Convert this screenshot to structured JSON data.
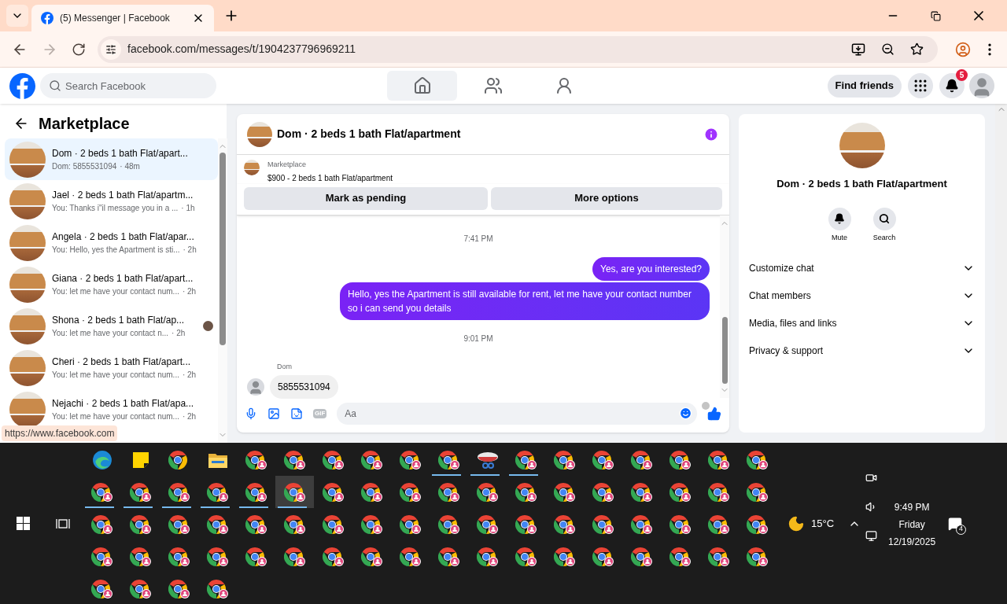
{
  "browser": {
    "tab_title": "(5) Messenger | Facebook",
    "url": "facebook.com/messages/t/1904237796969211",
    "forward_disabled": true,
    "status_url": "https://www.facebook.com"
  },
  "header": {
    "search_placeholder": "Search Facebook",
    "nav": [
      {
        "kind": "home",
        "selected": true
      },
      {
        "kind": "friends",
        "selected": false
      },
      {
        "kind": "groups",
        "selected": false
      }
    ],
    "find_friends": "Find friends",
    "notification_count": "5"
  },
  "sidebar": {
    "title": "Marketplace",
    "chats": [
      {
        "name": "Dom · 2 beds 1 bath Flat/apart...",
        "preview": "Dom: 5855531094",
        "time": "· 48m",
        "selected": true,
        "seen_avatar": false
      },
      {
        "name": "Jael · 2 beds 1 bath Flat/apartm...",
        "preview": "You: Thanks i\"il message you in a ...",
        "time": "· 1h",
        "selected": false,
        "seen_avatar": false
      },
      {
        "name": "Angela · 2 beds 1 bath Flat/apar...",
        "preview": "You: Hello, yes the Apartment is sti...",
        "time": "· 2h",
        "selected": false,
        "seen_avatar": false
      },
      {
        "name": "Giana · 2 beds 1 bath Flat/apart...",
        "preview": "You: let me have your contact num...",
        "time": "· 2h",
        "selected": false,
        "seen_avatar": false
      },
      {
        "name": "Shona · 2 beds 1 bath Flat/ap...",
        "preview": "You: let me have your contact n...",
        "time": "· 2h",
        "selected": false,
        "seen_avatar": true
      },
      {
        "name": "Cheri · 2 beds 1 bath Flat/apart...",
        "preview": "You: let me have your contact num...",
        "time": "· 2h",
        "selected": false,
        "seen_avatar": false
      },
      {
        "name": "Nejachi · 2 beds 1 bath Flat/apa...",
        "preview": "You: let me have your contact num...",
        "time": "· 2h",
        "selected": false,
        "seen_avatar": false
      }
    ]
  },
  "chat": {
    "title": "Dom · 2 beds 1 bath Flat/apartment",
    "listing": {
      "source": "Marketplace",
      "summary": "$900 - 2 beds 1 bath Flat/apartment"
    },
    "actions": [
      "Mark as pending",
      "More options"
    ],
    "messages": [
      {
        "kind": "time",
        "text": "7:41 PM"
      },
      {
        "kind": "outgoing",
        "text": "Yes, are you interested?"
      },
      {
        "kind": "outgoing",
        "text": "Hello, yes the Apartment is still available for rent, let me have your contact number so i can send you details"
      },
      {
        "kind": "time",
        "text": "9:01 PM"
      },
      {
        "kind": "incoming",
        "sender": "Dom",
        "text": "5855531094"
      }
    ],
    "composer": {
      "gif_label": "GIF",
      "placeholder": "Aa"
    }
  },
  "details": {
    "title": "Dom · 2 beds 1 bath Flat/apartment",
    "actions": [
      {
        "kind": "mute",
        "label": "Mute"
      },
      {
        "kind": "search",
        "label": "Search"
      }
    ],
    "sections": [
      {
        "label": "Customize chat",
        "expanded": false
      },
      {
        "label": "Chat members",
        "expanded": false
      },
      {
        "label": "Media, files and links",
        "expanded": false
      },
      {
        "label": "Privacy & support",
        "expanded": false
      }
    ]
  },
  "taskbar": {
    "rows": [
      [
        {
          "kind": "edge",
          "running": false,
          "selected": false
        },
        {
          "kind": "notes",
          "running": false,
          "selected": false
        },
        {
          "kind": "chrome",
          "running": false,
          "selected": false
        },
        {
          "kind": "folder",
          "running": false,
          "selected": false
        },
        {
          "kind": "chrome-profile",
          "running": false,
          "selected": false
        },
        {
          "kind": "chrome-profile",
          "running": false,
          "selected": false
        },
        {
          "kind": "chrome-profile",
          "running": false,
          "selected": false
        },
        {
          "kind": "chrome-profile",
          "running": false,
          "selected": false
        },
        {
          "kind": "chrome-profile",
          "running": false,
          "selected": false
        },
        {
          "kind": "chrome-profile",
          "running": true,
          "selected": false
        },
        {
          "kind": "scissors",
          "running": true,
          "selected": false
        },
        {
          "kind": "chrome-profile",
          "running": true,
          "selected": false
        },
        {
          "kind": "chrome-profile",
          "running": false,
          "selected": false
        },
        {
          "kind": "chrome-profile",
          "running": false,
          "selected": false
        },
        {
          "kind": "chrome-profile",
          "running": false,
          "selected": false
        },
        {
          "kind": "chrome-profile",
          "running": false,
          "selected": false
        },
        {
          "kind": "chrome-profile",
          "running": false,
          "selected": false
        },
        {
          "kind": "chrome-profile",
          "running": false,
          "selected": false
        }
      ],
      [
        {
          "kind": "chrome-profile",
          "running": true,
          "selected": false
        },
        {
          "kind": "chrome-profile",
          "running": true,
          "selected": false
        },
        {
          "kind": "chrome-profile",
          "running": true,
          "selected": false
        },
        {
          "kind": "chrome-profile",
          "running": true,
          "selected": false
        },
        {
          "kind": "chrome-profile",
          "running": true,
          "selected": false
        },
        {
          "kind": "chrome-profile",
          "running": true,
          "selected": true
        },
        {
          "kind": "chrome-profile",
          "running": false,
          "selected": false
        },
        {
          "kind": "chrome-profile",
          "running": false,
          "selected": false
        },
        {
          "kind": "chrome-profile",
          "running": false,
          "selected": false
        },
        {
          "kind": "chrome-profile",
          "running": false,
          "selected": false
        },
        {
          "kind": "chrome-profile",
          "running": false,
          "selected": false
        },
        {
          "kind": "chrome-profile",
          "running": false,
          "selected": false
        },
        {
          "kind": "chrome-profile",
          "running": false,
          "selected": false
        },
        {
          "kind": "chrome-profile",
          "running": false,
          "selected": false
        },
        {
          "kind": "chrome-profile",
          "running": false,
          "selected": false
        },
        {
          "kind": "chrome-profile",
          "running": false,
          "selected": false
        },
        {
          "kind": "chrome-profile",
          "running": false,
          "selected": false
        },
        {
          "kind": "chrome-profile",
          "running": false,
          "selected": false
        }
      ],
      [
        {
          "kind": "chrome-profile",
          "running": false,
          "selected": false
        },
        {
          "kind": "chrome-profile",
          "running": false,
          "selected": false
        },
        {
          "kind": "chrome-profile",
          "running": false,
          "selected": false
        },
        {
          "kind": "chrome-profile",
          "running": false,
          "selected": false
        },
        {
          "kind": "chrome-profile",
          "running": false,
          "selected": false
        },
        {
          "kind": "chrome-profile",
          "running": false,
          "selected": false
        },
        {
          "kind": "chrome-profile",
          "running": false,
          "selected": false
        },
        {
          "kind": "chrome-profile",
          "running": false,
          "selected": false
        },
        {
          "kind": "chrome-profile",
          "running": false,
          "selected": false
        },
        {
          "kind": "chrome-profile",
          "running": false,
          "selected": false
        },
        {
          "kind": "chrome-profile",
          "running": false,
          "selected": false
        },
        {
          "kind": "chrome-profile",
          "running": false,
          "selected": false
        },
        {
          "kind": "chrome-profile",
          "running": false,
          "selected": false
        },
        {
          "kind": "chrome-profile",
          "running": false,
          "selected": false
        },
        {
          "kind": "chrome-profile",
          "running": false,
          "selected": false
        },
        {
          "kind": "chrome-profile",
          "running": false,
          "selected": false
        },
        {
          "kind": "chrome-profile",
          "running": false,
          "selected": false
        },
        {
          "kind": "chrome-profile",
          "running": false,
          "selected": false
        }
      ],
      [
        {
          "kind": "chrome-profile",
          "running": false,
          "selected": false
        },
        {
          "kind": "chrome-profile",
          "running": false,
          "selected": false
        },
        {
          "kind": "chrome-profile",
          "running": false,
          "selected": false
        },
        {
          "kind": "chrome-profile",
          "running": false,
          "selected": false
        },
        {
          "kind": "chrome-profile",
          "running": false,
          "selected": false
        },
        {
          "kind": "chrome-profile",
          "running": false,
          "selected": false
        },
        {
          "kind": "chrome-profile",
          "running": false,
          "selected": false
        },
        {
          "kind": "chrome-profile",
          "running": false,
          "selected": false
        },
        {
          "kind": "chrome-profile",
          "running": false,
          "selected": false
        },
        {
          "kind": "chrome-profile",
          "running": false,
          "selected": false
        },
        {
          "kind": "chrome-profile",
          "running": false,
          "selected": false
        },
        {
          "kind": "chrome-profile",
          "running": false,
          "selected": false
        },
        {
          "kind": "chrome-profile",
          "running": false,
          "selected": false
        },
        {
          "kind": "chrome-profile",
          "running": false,
          "selected": false
        },
        {
          "kind": "chrome-profile",
          "running": false,
          "selected": false
        },
        {
          "kind": "chrome-profile",
          "running": false,
          "selected": false
        },
        {
          "kind": "chrome-profile",
          "running": false,
          "selected": false
        },
        {
          "kind": "chrome-profile",
          "running": false,
          "selected": false
        }
      ],
      [
        {
          "kind": "chrome-profile",
          "running": false,
          "selected": false
        },
        {
          "kind": "chrome-profile",
          "running": false,
          "selected": false
        },
        {
          "kind": "chrome-profile",
          "running": false,
          "selected": false
        },
        {
          "kind": "chrome-profile",
          "running": false,
          "selected": false
        }
      ]
    ],
    "weather": "15°C",
    "time": "9:49 PM",
    "day": "Friday",
    "date": "12/19/2025",
    "notification_count": "4"
  }
}
